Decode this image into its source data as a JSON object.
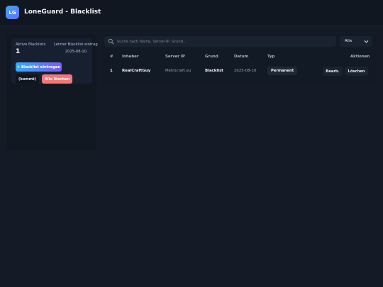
{
  "app": {
    "logo_text": "LG",
    "title": "LoneGuard - Blacklist"
  },
  "sidebar": {
    "stats": {
      "active_label": "Aktive Blacklists",
      "active_count": "1",
      "last_entry_label": "Letzter Blacklist eintrag",
      "last_entry_date": "2025-08-10"
    },
    "buttons": {
      "add_label": "+ Blacklist eintragen",
      "kommt_label": "(kommt)",
      "delete_all_label": "Alle löschen"
    }
  },
  "search": {
    "placeholder": "Suche nach Name, Server-IP, Grund...",
    "value": ""
  },
  "filter": {
    "selected": "Alle"
  },
  "table": {
    "headers": {
      "num": "#",
      "owner": "Inhaber",
      "server_ip": "Server IP",
      "reason": "Grund",
      "date": "Datum",
      "type": "Typ",
      "actions": "Aktionen"
    },
    "rows": [
      {
        "num": "1",
        "owner": "RealCraftGuy",
        "server_ip": "Metrocraft.eu",
        "reason": "Blacklist",
        "date": "2025-08-10",
        "type": "Permanent",
        "edit_label": "Bearb.",
        "delete_label": "Löschen"
      }
    ]
  },
  "colors": {
    "background": "#141b26",
    "accent_start": "#34aef2",
    "accent_end": "#7a5cf0",
    "danger": "#f27878"
  }
}
